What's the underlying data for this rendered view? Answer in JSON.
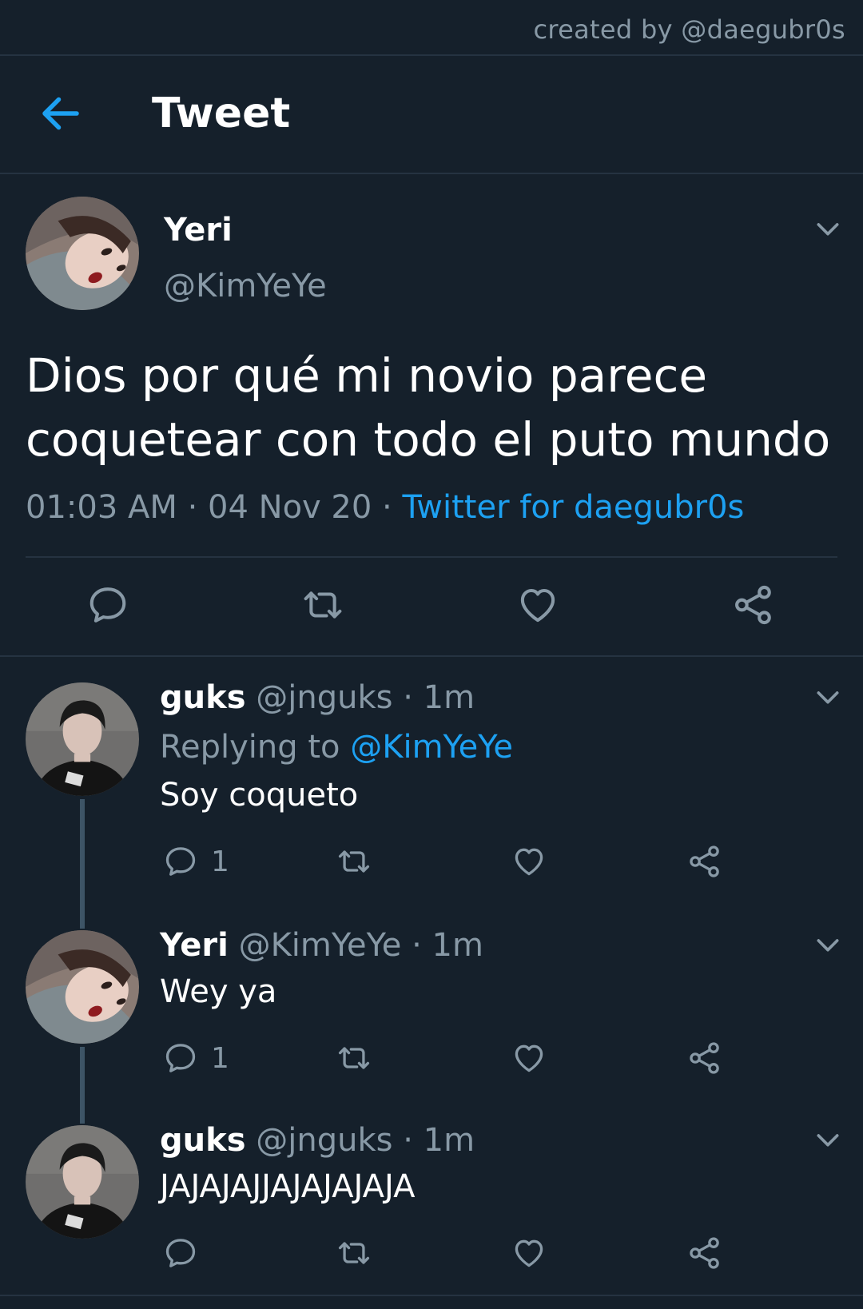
{
  "watermark": "created by @daegubr0s",
  "header": {
    "title": "Tweet"
  },
  "main_tweet": {
    "name": "Yeri",
    "handle": "@KimYeYe",
    "text": "Dios por qué mi novio parece coquetear con todo el puto mundo",
    "time": "01:03 AM",
    "dot": "·",
    "date": "04 Nov 20",
    "source": "Twitter for daegubr0s"
  },
  "replies": [
    {
      "name": "guks",
      "handle": "@jnguks",
      "dot": "·",
      "time": "1m",
      "replying_label": "Replying to",
      "replying_to": "@KimYeYe",
      "text": "Soy coqueto",
      "reply_count": "1"
    },
    {
      "name": "Yeri",
      "handle": "@KimYeYe",
      "dot": "·",
      "time": "1m",
      "text": "Wey ya",
      "reply_count": "1"
    },
    {
      "name": "guks",
      "handle": "@jnguks",
      "dot": "·",
      "time": "1m",
      "text": "JAJAJAJJAJAJAJAJA",
      "reply_count": ""
    }
  ],
  "colors": {
    "background": "#15202b",
    "accent": "#1da1f2",
    "muted": "#8899a6",
    "divider": "#253341"
  },
  "icons": [
    "back-arrow-icon",
    "chevron-down-icon",
    "reply-icon",
    "retweet-icon",
    "like-icon",
    "share-icon"
  ]
}
